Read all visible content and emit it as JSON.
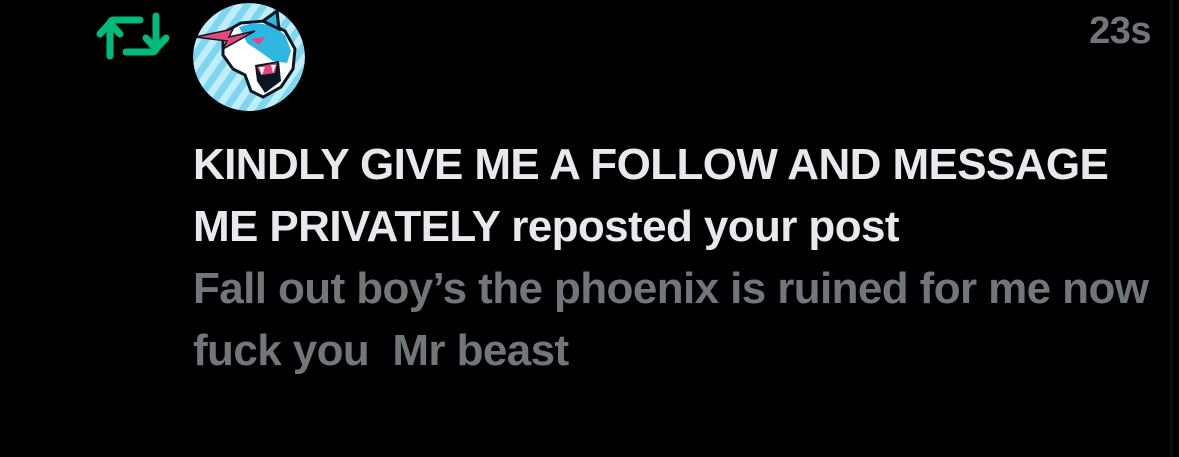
{
  "notification": {
    "type_icon": "repost-icon",
    "avatar_icon": "mrbeast-panther-logo-icon",
    "timestamp": "23s",
    "actor_name": "KINDLY GIVE ME A FOLLOW AND MESSAGE ME PRIVATELY",
    "action_text": " reposted your post",
    "post_text": "Fall out boy’s the phoenix is ruined for me now fuck you  Mr beast"
  },
  "colors": {
    "background": "#000000",
    "repost_green": "#00ba7c",
    "primary_text": "#e7e9ea",
    "secondary_text": "#71767b",
    "avatar_light_blue": "#9fe3f5",
    "brand_pink": "#e8457a"
  }
}
